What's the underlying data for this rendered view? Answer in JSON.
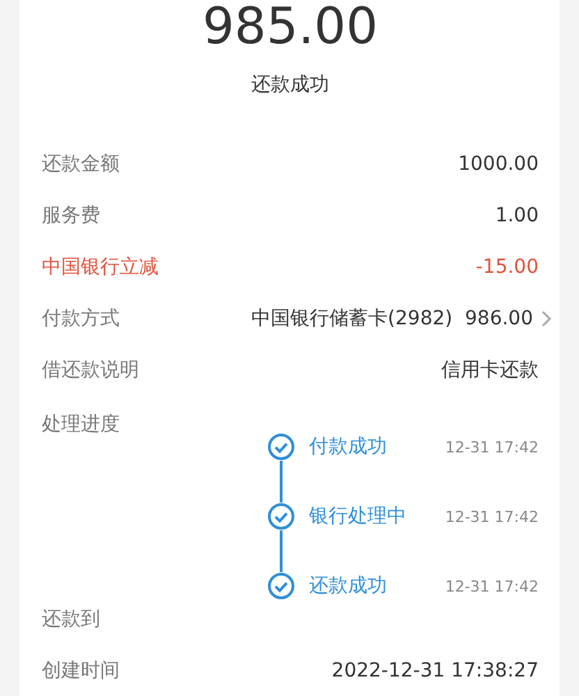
{
  "amount": "985.00",
  "status": "还款成功",
  "rows": [
    {
      "kind": "plain",
      "label": "还款金额",
      "value": "1000.00"
    },
    {
      "kind": "plain",
      "label": "服务费",
      "value": "1.00"
    },
    {
      "kind": "discount",
      "label": "中国银行立减",
      "value": "-15.00"
    },
    {
      "kind": "link",
      "label": "付款方式",
      "value": "中国银行储蓄卡(2982)  986.00"
    },
    {
      "kind": "plain",
      "label": "借还款说明",
      "value": "信用卡还款"
    },
    {
      "kind": "progress",
      "label": "处理进度",
      "steps": [
        {
          "label": "付款成功",
          "time": "12-31 17:42"
        },
        {
          "label": "银行处理中",
          "time": "12-31 17:42"
        },
        {
          "label": "还款成功",
          "time": "12-31 17:42"
        }
      ]
    },
    {
      "kind": "plain",
      "label": "还款到"
    },
    {
      "kind": "plain",
      "label": "创建时间",
      "value": "2022-12-31 17:38:27"
    }
  ]
}
